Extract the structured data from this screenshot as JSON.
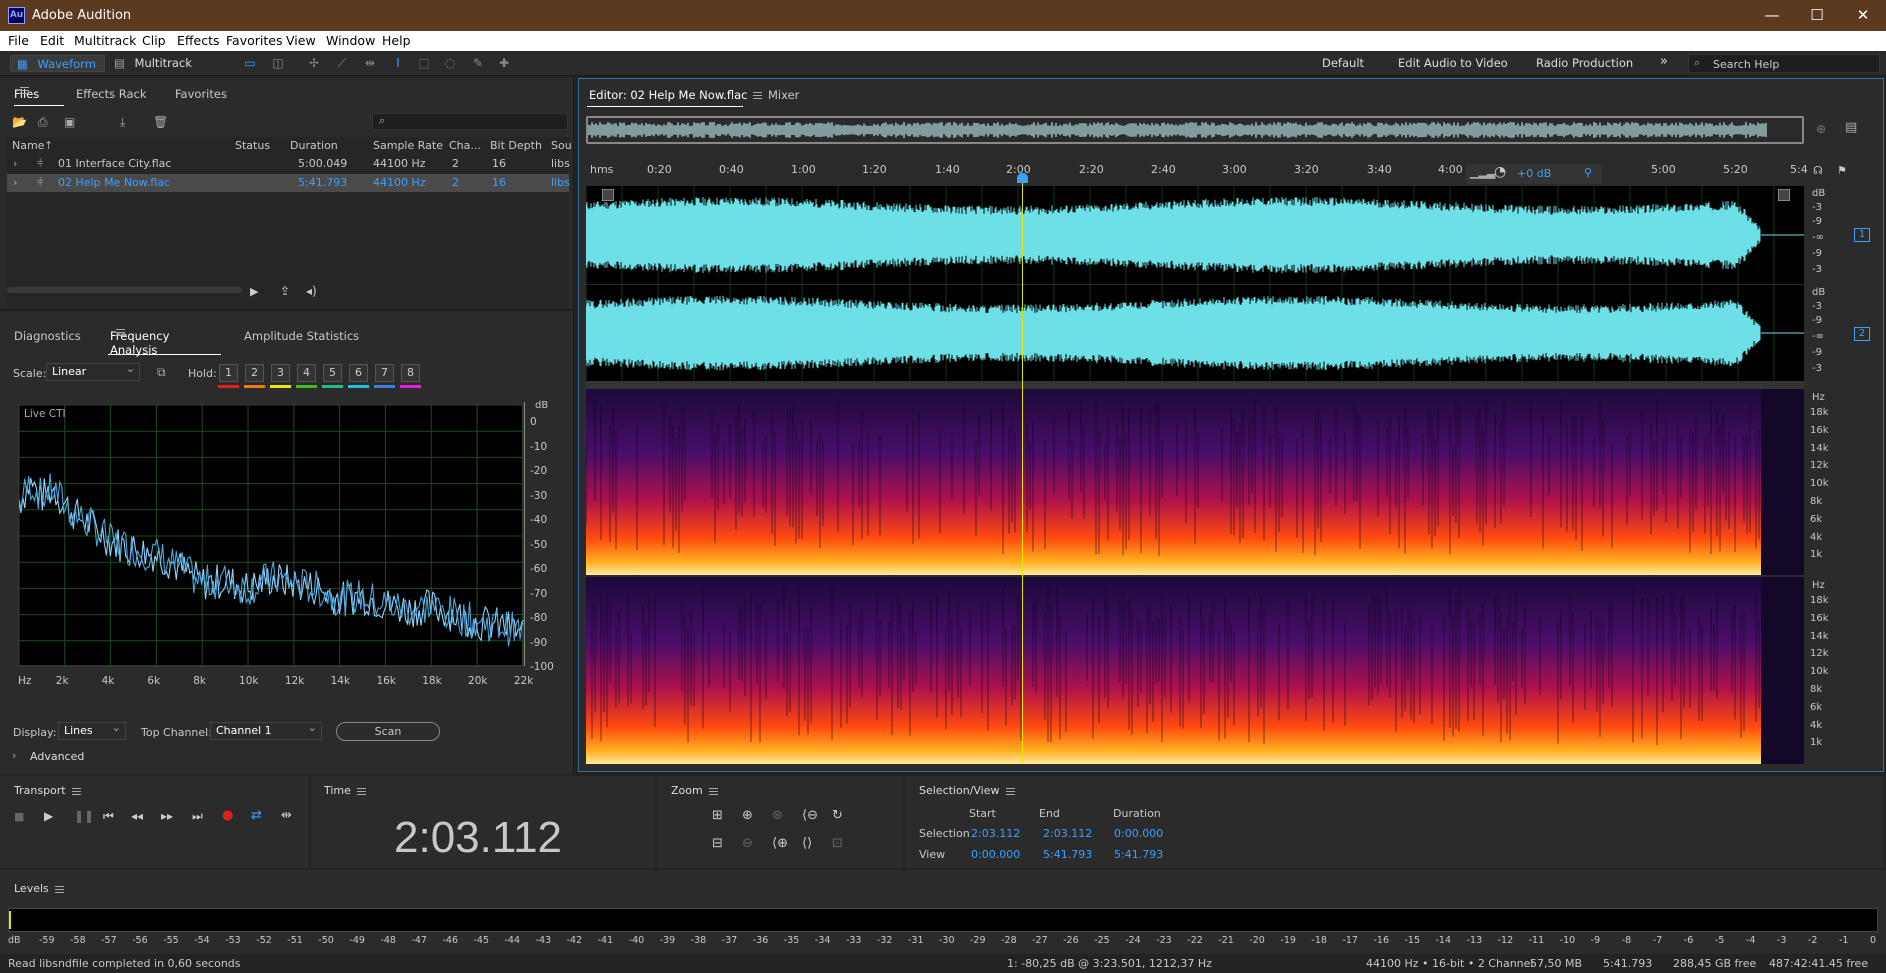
{
  "app": {
    "title": "Adobe Audition",
    "logo_text": "Au"
  },
  "menu": [
    "File",
    "Edit",
    "Multitrack",
    "Clip",
    "Effects",
    "Favorites",
    "View",
    "Window",
    "Help"
  ],
  "toolbar": {
    "waveform_label": "Waveform",
    "multitrack_label": "Multitrack",
    "workspaces": [
      "Default",
      "Edit Audio to Video",
      "Radio Production"
    ],
    "more": "»",
    "search_placeholder": "Search Help"
  },
  "files_panel": {
    "tabs": [
      "Files",
      "Effects Rack",
      "Favorites"
    ],
    "columns": [
      "Name",
      "Status",
      "Duration",
      "Sample Rate",
      "Cha...",
      "Bit Depth",
      "Sou"
    ],
    "rows": [
      {
        "name": "01 Interface City.flac",
        "status": "",
        "duration": "5:00.049",
        "rate": "44100 Hz",
        "channels": "2",
        "bits": "16",
        "source": "libs"
      },
      {
        "name": "02 Help Me Now.flac",
        "status": "",
        "duration": "5:41.793",
        "rate": "44100 Hz",
        "channels": "2",
        "bits": "16",
        "source": "libs"
      }
    ],
    "search_placeholder": "",
    "search_icon_glyph": "⌕"
  },
  "freq_panel": {
    "tabs": [
      "Diagnostics",
      "Frequency Analysis",
      "Amplitude Statistics"
    ],
    "scale_label": "Scale:",
    "scale_value": "Linear",
    "hold_label": "Hold:",
    "holds": [
      "1",
      "2",
      "3",
      "4",
      "5",
      "6",
      "7",
      "8"
    ],
    "hold_colors": [
      "#e02020",
      "#f07a10",
      "#f0e010",
      "#40c020",
      "#20c080",
      "#20c0e0",
      "#3a7ee0",
      "#e020e0"
    ],
    "graph_label": "Live CTI",
    "db_unit": "dB",
    "db_ticks": [
      "0",
      "-10",
      "-20",
      "-30",
      "-40",
      "-50",
      "-60",
      "-70",
      "-80",
      "-90",
      "-100"
    ],
    "hz_ticks": [
      "Hz",
      "2k",
      "4k",
      "6k",
      "8k",
      "10k",
      "12k",
      "14k",
      "16k",
      "18k",
      "20k",
      "22k"
    ],
    "display_label": "Display:",
    "display_value": "Lines",
    "top_channel_label": "Top Channel:",
    "top_channel_value": "Channel 1",
    "scan_label": "Scan",
    "advanced_label": "Advanced"
  },
  "chart_data": {
    "type": "line",
    "title": "",
    "xlabel": "Hz",
    "ylabel": "dB",
    "xlim": [
      0,
      22050
    ],
    "ylim": [
      -100,
      0
    ],
    "series": [
      {
        "x": [
          0,
          500,
          1000,
          1500,
          2000,
          2500,
          3000,
          3500,
          4000,
          5000,
          6000,
          7000,
          8000,
          9000,
          10000,
          11000,
          12000,
          13000,
          14000,
          15000,
          16000,
          17000,
          18000,
          19000,
          20000,
          21000,
          22000
        ],
        "values": [
          -37,
          -30,
          -35,
          -32,
          -38,
          -42,
          -45,
          -48,
          -52,
          -55,
          -57,
          -62,
          -68,
          -67,
          -70,
          -66,
          -68,
          -70,
          -74,
          -73,
          -76,
          -78,
          -77,
          -80,
          -83,
          -84,
          -87
        ]
      }
    ]
  },
  "editor": {
    "tab_label": "Editor: 02 Help Me Now.flac",
    "mixer_label": "Mixer",
    "ruler_unit": "hms",
    "ruler_ticks": [
      "0:20",
      "0:40",
      "1:00",
      "1:20",
      "1:40",
      "2:00",
      "2:20",
      "2:40",
      "3:00",
      "3:20",
      "3:40",
      "4:00",
      "5:00",
      "5:20",
      "5:4"
    ],
    "gain_label": "+0 dB",
    "channel_db_unit": "dB",
    "channel_db_ticks": [
      "-9",
      "-∞",
      "-9",
      "-3"
    ],
    "channel_db_top": "-3",
    "channel_numbers": [
      "1",
      "2"
    ],
    "spec_hz_unit": "Hz",
    "spec_hz_ticks": [
      "18k",
      "16k",
      "14k",
      "12k",
      "10k",
      "8k",
      "6k",
      "4k",
      "1k"
    ],
    "playhead_fraction": 0.361
  },
  "transport": {
    "title": "Transport"
  },
  "time": {
    "title": "Time",
    "value": "2:03.112"
  },
  "zoom": {
    "title": "Zoom"
  },
  "selection": {
    "title": "Selection/View",
    "cols": [
      "Start",
      "End",
      "Duration"
    ],
    "selection_label": "Selection",
    "selection": [
      "2:03.112",
      "2:03.112",
      "0:00.000"
    ],
    "view_label": "View",
    "view": [
      "0:00.000",
      "5:41.793",
      "5:41.793"
    ]
  },
  "levels": {
    "title": "Levels",
    "ticks": [
      "dB",
      "-59",
      "-58",
      "-57",
      "-56",
      "-55",
      "-54",
      "-53",
      "-52",
      "-51",
      "-50",
      "-49",
      "-48",
      "-47",
      "-46",
      "-45",
      "-44",
      "-43",
      "-42",
      "-41",
      "-40",
      "-39",
      "-38",
      "-37",
      "-36",
      "-35",
      "-34",
      "-33",
      "-32",
      "-31",
      "-30",
      "-29",
      "-28",
      "-27",
      "-26",
      "-25",
      "-24",
      "-23",
      "-22",
      "-21",
      "-20",
      "-19",
      "-18",
      "-17",
      "-16",
      "-15",
      "-14",
      "-13",
      "-12",
      "-11",
      "-10",
      "-9",
      "-8",
      "-7",
      "-6",
      "-5",
      "-4",
      "-3",
      "-2",
      "-1",
      "0"
    ]
  },
  "status": {
    "left": "Read libsndfile completed in 0,60 seconds",
    "cursor": "1: -80,25 dB @ 3:23.501, 1212,37 Hz",
    "format": "44100 Hz • 16-bit • 2 Channel",
    "size": "57,50 MB",
    "duration": "5:41.793",
    "free": "288,45 GB free",
    "time_free": "487:42:41.45 free"
  }
}
